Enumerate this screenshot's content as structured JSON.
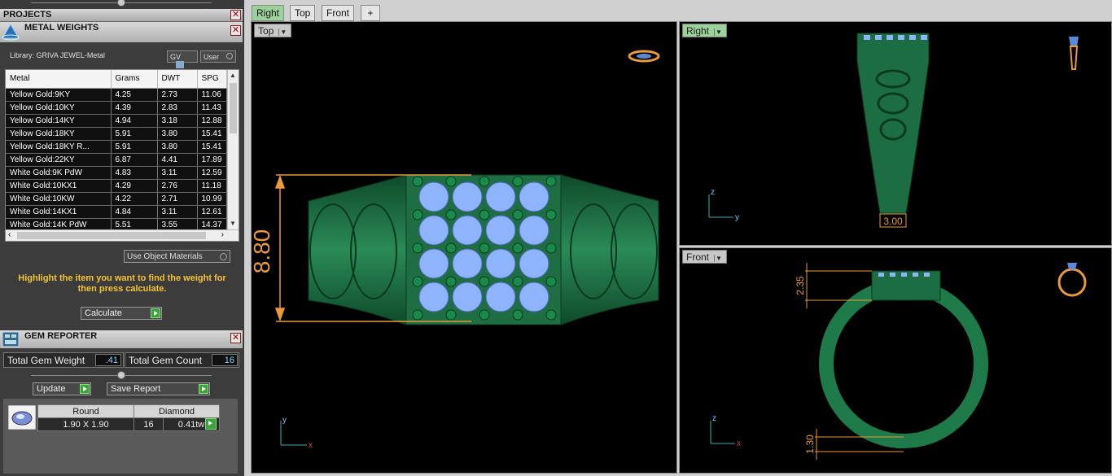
{
  "projects": {
    "title": "PROJECTS"
  },
  "metal_weights": {
    "title": "METAL WEIGHTS",
    "library": "Library: GRIVA JEWEL-Metal",
    "gv_label": "GV",
    "user_label": "User",
    "columns": [
      "Metal",
      "Grams",
      "DWT",
      "SPG"
    ],
    "rows": [
      [
        "Yellow Gold:9KY",
        "4.25",
        "2.73",
        "11.06"
      ],
      [
        "Yellow Gold:10KY",
        "4.39",
        "2.83",
        "11.43"
      ],
      [
        "Yellow Gold:14KY",
        "4.94",
        "3.18",
        "12.88"
      ],
      [
        "Yellow Gold:18KY",
        "5.91",
        "3.80",
        "15.41"
      ],
      [
        "Yellow Gold:18KY R...",
        "5.91",
        "3.80",
        "15.41"
      ],
      [
        "Yellow Gold:22KY",
        "6.87",
        "4.41",
        "17.89"
      ],
      [
        "White Gold:9K PdW",
        "4.83",
        "3.11",
        "12.59"
      ],
      [
        "White Gold:10KX1",
        "4.29",
        "2.76",
        "11.18"
      ],
      [
        "White Gold:10KW",
        "4.22",
        "2.71",
        "10.99"
      ],
      [
        "White Gold:14KX1",
        "4.84",
        "3.11",
        "12.61"
      ],
      [
        "White Gold:14K PdW",
        "5.51",
        "3.55",
        "14.37"
      ]
    ],
    "use_object_materials": "Use Object Materials",
    "hint": "Highlight the item you want to find the weight for then press calculate.",
    "calculate": "Calculate"
  },
  "gem_reporter": {
    "title": "GEM REPORTER",
    "total_weight_label": "Total Gem Weight",
    "total_weight": ".41",
    "total_count_label": "Total Gem Count",
    "total_count": "16",
    "update": "Update",
    "save_report": "Save Report",
    "shape_header": "Round",
    "type_header": "Diamond",
    "size": "1.90 X 1.90",
    "count": "16",
    "weight": "0.41tw"
  },
  "tabs": [
    "Right",
    "Top",
    "Front"
  ],
  "viewports": {
    "top": {
      "label": "Top",
      "dim": "8.80",
      "axis_y": "y",
      "axis_x": "x"
    },
    "right": {
      "label": "Right",
      "dim": "3.00",
      "axis_z": "z",
      "axis_y": "y"
    },
    "front": {
      "label": "Front",
      "dim_top": "2.35",
      "dim_bottom": "1.30",
      "axis_z": "z",
      "axis_x": "x"
    }
  },
  "colors": {
    "metal": "#1f7a4a",
    "gem": "#8fb4ff",
    "dimension": "#e89a3c",
    "panel": "#3c3c3c"
  }
}
